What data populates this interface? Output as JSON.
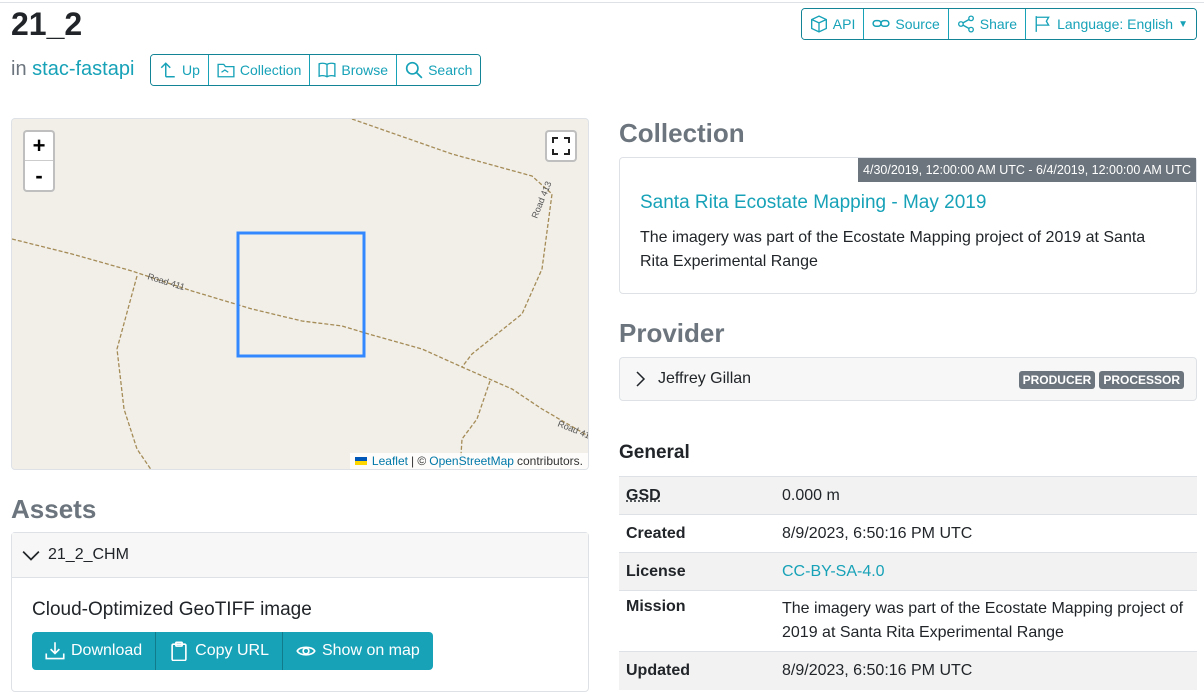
{
  "page": {
    "title": "21_2",
    "in_label": "in",
    "catalog_link": "stac-fastapi"
  },
  "top_buttons": {
    "api": "API",
    "source": "Source",
    "share": "Share",
    "language": "Language: English"
  },
  "nav_buttons": {
    "up": "Up",
    "collection": "Collection",
    "browse": "Browse",
    "search": "Search"
  },
  "map": {
    "zoom_in": "+",
    "zoom_out": "-",
    "road_labels": [
      "Road 411",
      "Road 413",
      "Road 41"
    ],
    "attribution": {
      "leaflet": "Leaflet",
      "separator": "| ©",
      "osm": "OpenStreetMap",
      "suffix": "contributors."
    },
    "colors": {
      "footprint": "#3388ff",
      "road": "#a58c57",
      "background": "#f2efe9"
    }
  },
  "assets": {
    "heading": "Assets",
    "item_name": "21_2_CHM",
    "description": "Cloud-Optimized GeoTIFF image",
    "buttons": {
      "download": "Download",
      "copy_url": "Copy URL",
      "show_on_map": "Show on map"
    }
  },
  "collection": {
    "heading": "Collection",
    "date_range": "4/30/2019, 12:00:00 AM UTC - 6/4/2019, 12:00:00 AM UTC",
    "title": "Santa Rita Ecostate Mapping - May 2019",
    "description": "The imagery was part of the Ecostate Mapping project of 2019 at Santa Rita Experimental Range"
  },
  "provider": {
    "heading": "Provider",
    "name": "Jeffrey Gillan",
    "roles": [
      "PRODUCER",
      "PROCESSOR"
    ]
  },
  "general": {
    "heading": "General",
    "rows": [
      {
        "key": "GSD",
        "value": "0.000 m"
      },
      {
        "key": "Created",
        "value": "8/9/2023, 6:50:16 PM UTC"
      },
      {
        "key": "License",
        "value": "CC-BY-SA-4.0"
      },
      {
        "key": "Mission",
        "value": "The imagery was part of the Ecostate Mapping project of 2019 at Santa Rita Experimental Range"
      },
      {
        "key": "Updated",
        "value": "8/9/2023, 6:50:16 PM UTC"
      }
    ]
  },
  "colors": {
    "accent": "#17a2b8",
    "muted": "#6c757d"
  }
}
